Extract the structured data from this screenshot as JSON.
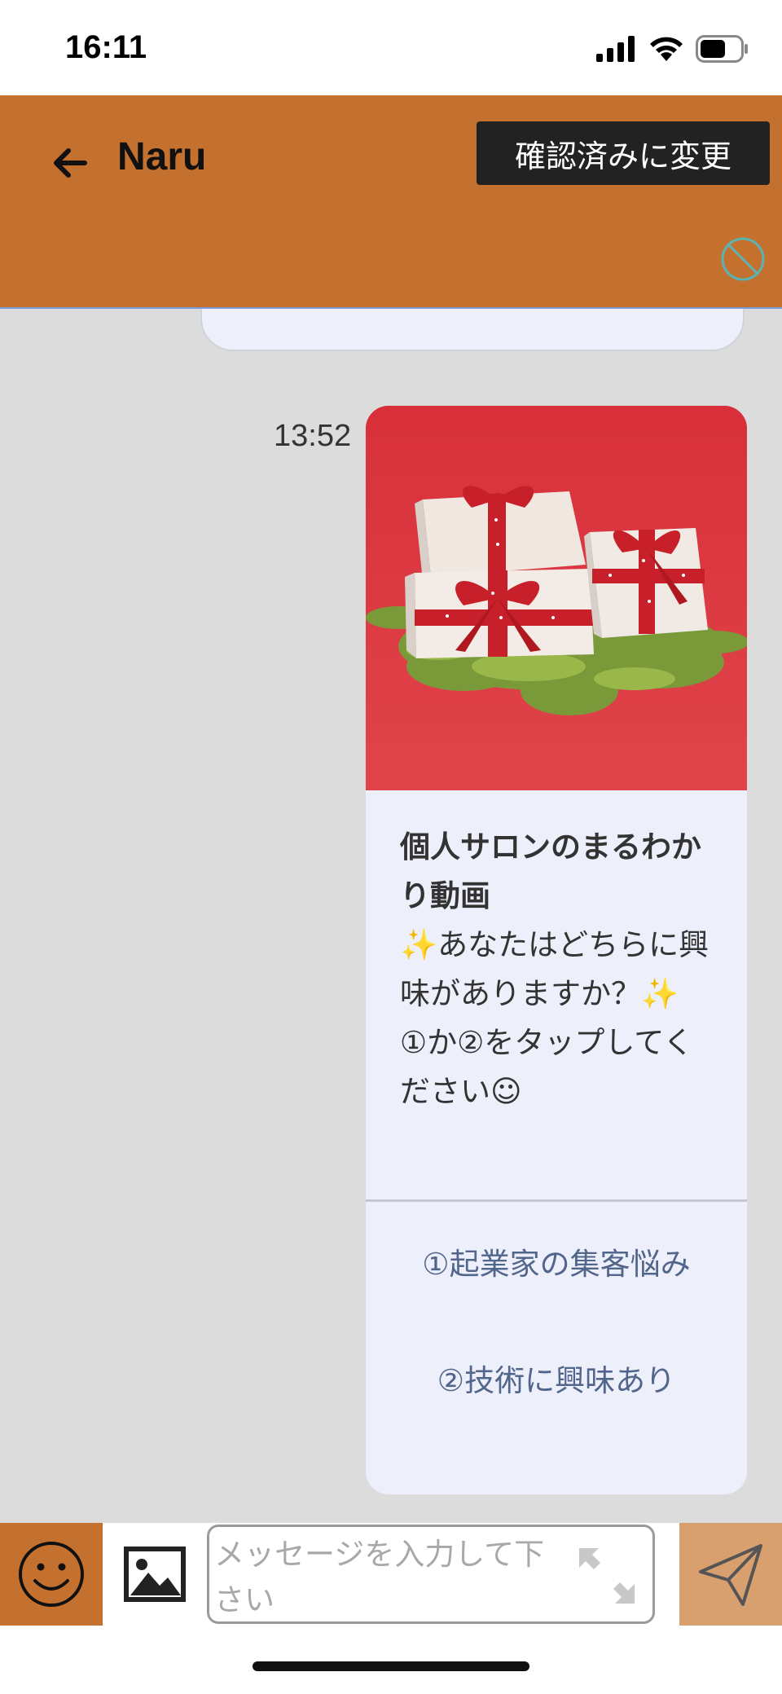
{
  "status_bar": {
    "time": "16:11",
    "icons": [
      "cellular-signal-icon",
      "wifi-icon",
      "battery-icon"
    ]
  },
  "header": {
    "back_icon": "arrow-left-icon",
    "title": "Naru",
    "confirm_label": "確認済みに変更",
    "block_icon": "prohibited-icon",
    "background_color": "#c47130"
  },
  "chat": {
    "message": {
      "time": "13:52",
      "card": {
        "image_description_icon": "gift-boxes-image",
        "title": "個人サロンのまるわかり動画",
        "text": "✨あなたはどちらに興味がありますか？✨ ①か②をタップしてください☺",
        "actions": [
          {
            "label": "①起業家の集客悩み"
          },
          {
            "label": "②技術に興味あり"
          }
        ]
      }
    }
  },
  "input_bar": {
    "emoji_icon": "smiley-face-icon",
    "image_icon": "image-icon",
    "placeholder": "メッセージを入力して下さい",
    "value": "",
    "expand_icon": "expand-arrows-icon",
    "send_icon": "paper-plane-send-icon",
    "accent_color": "#c47130",
    "send_color": "#d8a06e"
  }
}
